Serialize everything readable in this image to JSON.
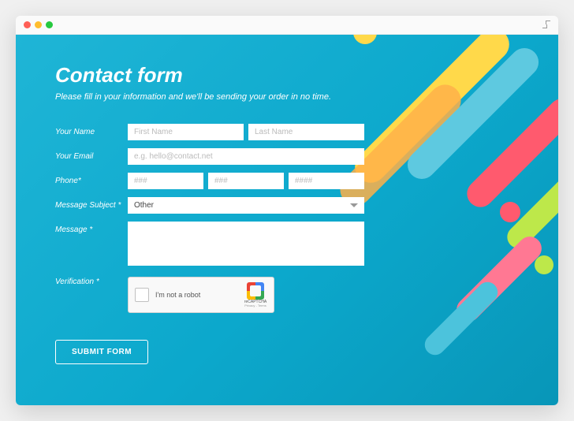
{
  "header": {
    "title": "Contact form",
    "subtitle": "Please fill in your information and we'll be sending your order in no time."
  },
  "form": {
    "name": {
      "label": "Your Name",
      "first_placeholder": "First Name",
      "last_placeholder": "Last Name"
    },
    "email": {
      "label": "Your Email",
      "placeholder": "e.g. hello@contact.net"
    },
    "phone": {
      "label": "Phone*",
      "p1": "###",
      "p2": "###",
      "p3": "####"
    },
    "subject": {
      "label": "Message Subject *",
      "selected": "Other"
    },
    "message": {
      "label": "Message *"
    },
    "verification": {
      "label": "Verification *",
      "captcha_text": "I'm not a robot",
      "captcha_brand": "reCAPTCHA",
      "captcha_terms": "Privacy - Terms"
    },
    "submit_label": "SUBMIT FORM"
  }
}
